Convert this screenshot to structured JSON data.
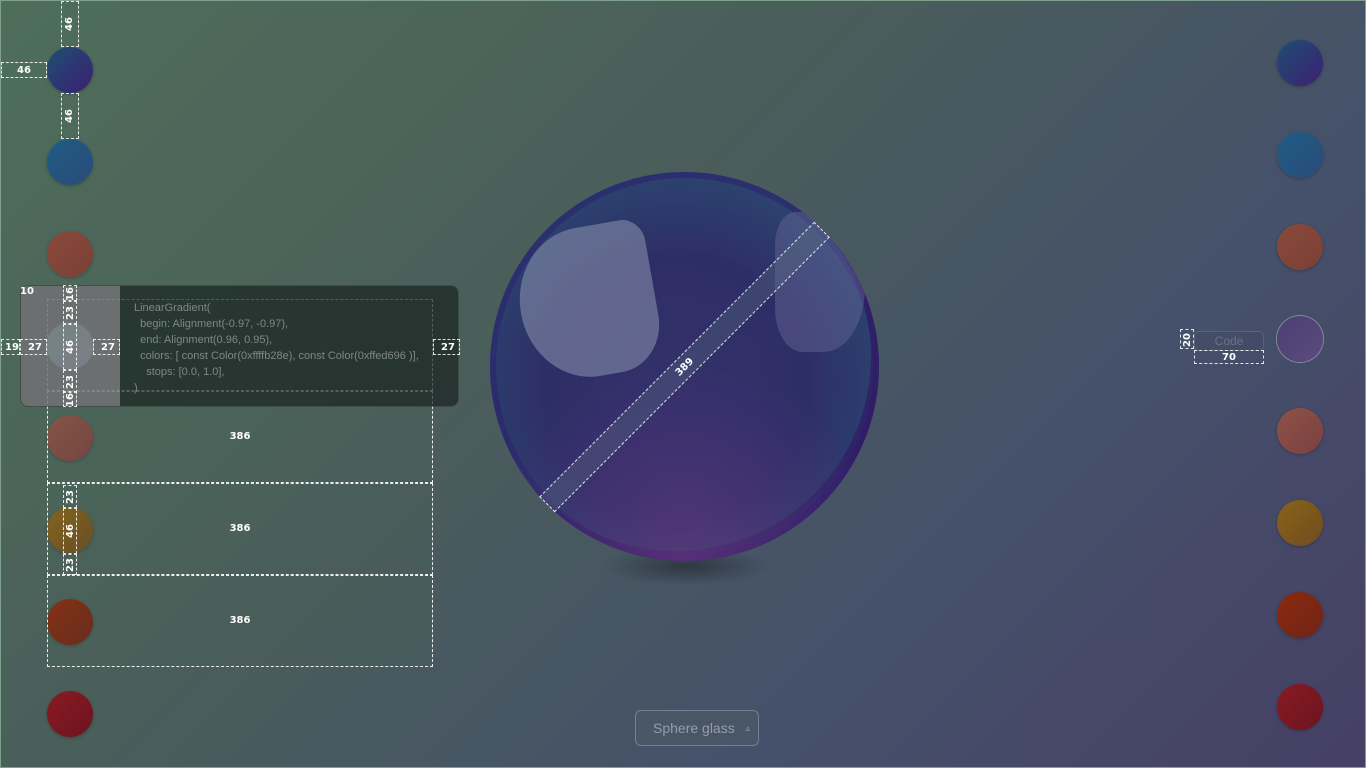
{
  "left_swatches": [
    {
      "name": "purple-blue",
      "from": "#1d4f72",
      "to": "#3d1f73"
    },
    {
      "name": "ocean-blue",
      "from": "#1f5d86",
      "to": "#2a4a78"
    },
    {
      "name": "rust",
      "from": "#8a4a3a",
      "to": "#7a3f37"
    },
    {
      "name": "mint-selected",
      "from": "#7fe3c6",
      "to": "#a9c3e8"
    },
    {
      "name": "dusty-rose",
      "from": "#8f5247",
      "to": "#7b4040"
    },
    {
      "name": "amber",
      "from": "#8a6318",
      "to": "#6e4c20"
    },
    {
      "name": "brick",
      "from": "#8c2a0c",
      "to": "#6e2418"
    },
    {
      "name": "crimson",
      "from": "#8a1a22",
      "to": "#6b1420"
    }
  ],
  "right_swatches": [
    {
      "name": "purple-blue",
      "from": "#1d4f72",
      "to": "#3d1f73"
    },
    {
      "name": "ocean-blue",
      "from": "#1f5d86",
      "to": "#2a4a78"
    },
    {
      "name": "rust",
      "from": "#8a4a3a",
      "to": "#7a3f37"
    },
    {
      "name": "lavender-selected",
      "from": "#4a3f72",
      "to": "#5c4a7e"
    },
    {
      "name": "dusty-rose",
      "from": "#8f5247",
      "to": "#7b4040"
    },
    {
      "name": "amber",
      "from": "#8a6318",
      "to": "#6e4c20"
    },
    {
      "name": "brick",
      "from": "#8c2a0c",
      "to": "#6e2418"
    },
    {
      "name": "crimson",
      "from": "#8a1a22",
      "to": "#6b1420"
    }
  ],
  "code": {
    "lines": [
      "LinearGradient(",
      "  begin: Alignment(-0.97, -0.97),",
      "  end: Alignment(0.96, 0.95),",
      "  colors: [ const Color(0xffffb28e), const Color(0xffed696 )],",
      "    stops: [0.0, 1.0],",
      ")"
    ]
  },
  "code_button": {
    "label": "Code"
  },
  "style_select": {
    "value": "Sphere glass",
    "caret": "▵"
  },
  "dimensions": {
    "d46": "46",
    "d27": "27",
    "d23": "23",
    "d19": "19",
    "d16": "16",
    "d10": "10",
    "d20": "20",
    "d70": "70",
    "d386": "386",
    "d389": "389"
  }
}
